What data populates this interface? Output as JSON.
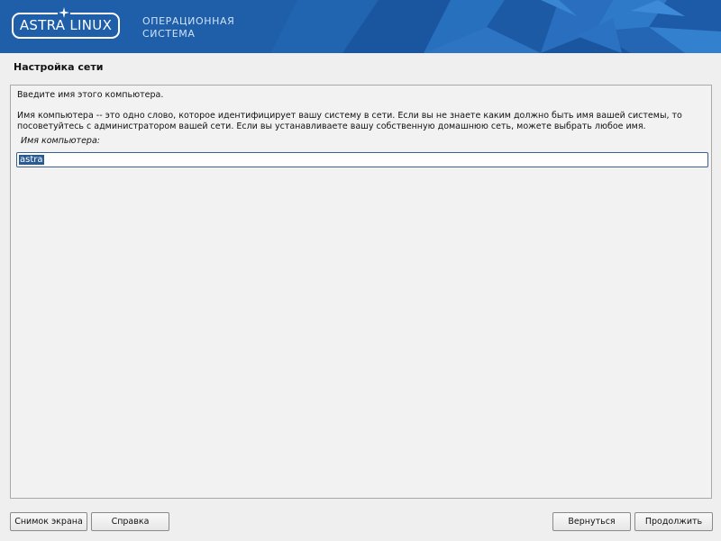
{
  "header": {
    "logo_text": "ASTRA LINUX",
    "subtitle_line1": "ОПЕРАЦИОННАЯ",
    "subtitle_line2": "СИСТЕМА",
    "background_color": "#1f5ea8"
  },
  "section": {
    "title": "Настройка сети"
  },
  "content": {
    "prompt": "Введите имя этого компьютера.",
    "description": "Имя компьютера -- это одно слово, которое идентифицирует вашу систему в сети. Если вы не знаете каким должно быть имя вашей системы, то посоветуйтесь с администратором вашей сети. Если вы устанавливаете вашу собственную домашнюю сеть, можете выбрать любое имя.",
    "field_label": "Имя компьютера:",
    "hostname_value": "astra"
  },
  "buttons": {
    "screenshot": "Снимок экрана",
    "help": "Справка",
    "back": "Вернуться",
    "continue": "Продолжить"
  }
}
